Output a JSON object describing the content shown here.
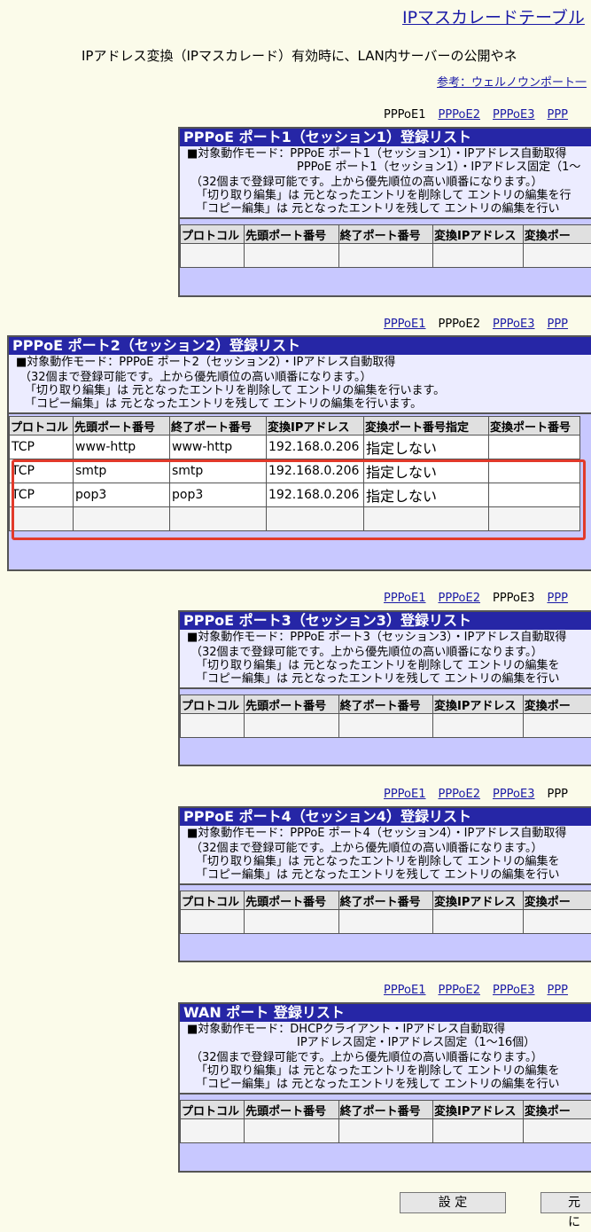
{
  "page": {
    "title": "IPマスカレードテーブル",
    "intro": "IPアドレス変換（IPマスカレード）有効時に、LAN内サーバーの公開やネ",
    "ref_link": "参考：ウェルノウンポート一"
  },
  "tabs": [
    "PPPoE1",
    "PPPoE2",
    "PPPoE3",
    "PPP"
  ],
  "columns": [
    "プロトコル",
    "先頭ポート番号",
    "終了ポート番号",
    "変換IPアドレス",
    "変換ポート番号指定",
    "変換ポート番号"
  ],
  "columns_short": [
    "プロトコル",
    "先頭ポート番号",
    "終了ポート番号",
    "変換IPアドレス",
    "変換ポー"
  ],
  "panels": [
    {
      "header": "PPPoE ポート1（セッション1）登録リスト",
      "mode1": "■対象動作モード：PPPoE ポート1（セッション1）・IPアドレス自動取得",
      "mode2": "PPPoE ポート1（セッション1）・IPアドレス固定（1～",
      "note1": "（32個まで登録可能です。上から優先順位の高い順番になります。）",
      "note2": "「切り取り編集」は 元となったエントリを削除して エントリの編集を行",
      "note3": "「コピー編集」は 元となったエントリを残して エントリの編集を行い"
    },
    {
      "header": "PPPoE ポート2（セッション2）登録リスト",
      "mode1": "■対象動作モード：PPPoE ポート2（セッション2）・IPアドレス自動取得",
      "note1": "（32個まで登録可能です。上から優先順位の高い順番になります。）",
      "note2": "「切り取り編集」は 元となったエントリを削除して エントリの編集を行います。",
      "note3": "「コピー編集」は 元となったエントリを残して エントリの編集を行います。",
      "rows": [
        {
          "protocol": "TCP",
          "start": "www-http",
          "end": "www-http",
          "ip": "192.168.0.206",
          "spec": "指定しない",
          "port": ""
        },
        {
          "protocol": "TCP",
          "start": "smtp",
          "end": "smtp",
          "ip": "192.168.0.206",
          "spec": "指定しない",
          "port": ""
        },
        {
          "protocol": "TCP",
          "start": "pop3",
          "end": "pop3",
          "ip": "192.168.0.206",
          "spec": "指定しない",
          "port": ""
        }
      ]
    },
    {
      "header": "PPPoE ポート3（セッション3）登録リスト",
      "mode1": "■対象動作モード：PPPoE ポート3（セッション3）・IPアドレス自動取得",
      "note1": "（32個まで登録可能です。上から優先順位の高い順番になります。）",
      "note2": "「切り取り編集」は 元となったエントリを削除して エントリの編集を",
      "note3": "「コピー編集」は 元となったエントリを残して エントリの編集を行い"
    },
    {
      "header": "PPPoE ポート4（セッション4）登録リスト",
      "mode1": "■対象動作モード：PPPoE ポート4（セッション4）・IPアドレス自動取得",
      "note1": "（32個まで登録可能です。上から優先順位の高い順番になります。）",
      "note2": "「切り取り編集」は 元となったエントリを削除して エントリの編集を",
      "note3": "「コピー編集」は 元となったエントリを残して エントリの編集を行い"
    },
    {
      "header": "WAN ポート 登録リスト",
      "mode1": "■対象動作モード：DHCPクライアント・IPアドレス自動取得",
      "mode2": "IPアドレス固定・IPアドレス固定（1～16個）",
      "note1": "（32個まで登録可能です。上から優先順位の高い順番になります。）",
      "note2": "「切り取り編集」は 元となったエントリを削除して エントリの編集を",
      "note3": "「コピー編集」は 元となったエントリを残して エントリの編集を行い"
    }
  ],
  "buttons": {
    "set": "設 定",
    "restore": "元に"
  }
}
